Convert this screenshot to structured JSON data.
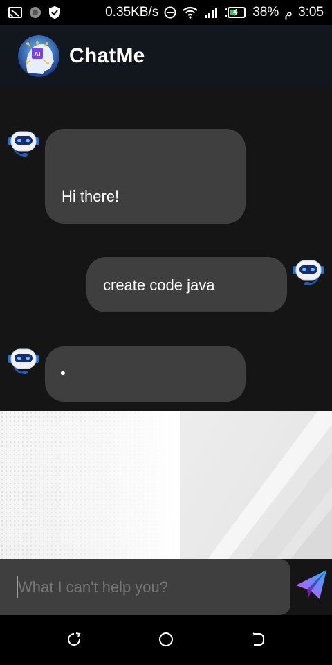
{
  "status_bar": {
    "network_speed": "0.35KB/s",
    "battery_percent": "38%",
    "period": "م",
    "time": "3:05",
    "icons": [
      "screencast-icon",
      "circle-app-icon",
      "shield-icon",
      "do-not-disturb-icon",
      "wifi-icon",
      "signal-icon",
      "battery-charging-icon"
    ]
  },
  "app_bar": {
    "title": "ChatMe",
    "logo": "ai-head-logo"
  },
  "messages": [
    {
      "sender": "bot",
      "text": "Hi there!",
      "avatar": "robot-icon"
    },
    {
      "sender": "user",
      "text": "create code java",
      "avatar": "robot-icon"
    },
    {
      "sender": "bot",
      "text": "•",
      "avatar": "robot-icon"
    }
  ],
  "input": {
    "placeholder": "What I can't help you?",
    "value": ""
  },
  "send_button": {
    "icon": "paper-plane-icon"
  },
  "nav_bar": {
    "buttons": [
      "recent-apps-icon",
      "home-icon",
      "back-icon"
    ]
  },
  "colors": {
    "background": "#151515",
    "app_bar": "#11171c",
    "bubble": "#3f3f3f",
    "send_gradient_start": "#e040fb",
    "send_gradient_end": "#29b6f6"
  }
}
